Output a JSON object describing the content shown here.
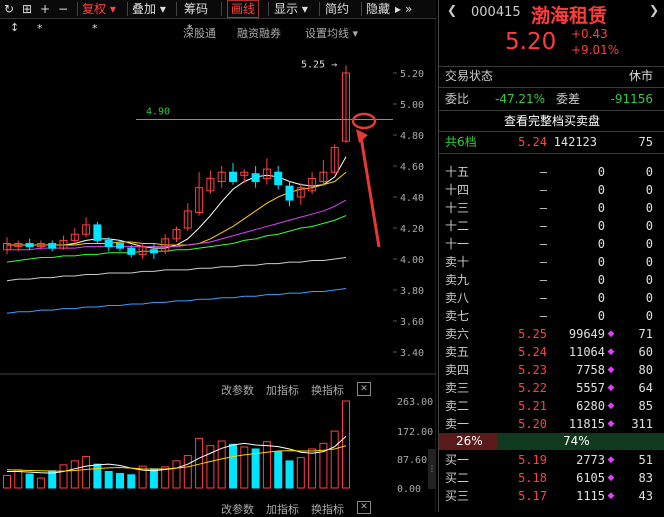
{
  "toolbar": {
    "refresh_icon": "refresh-icon",
    "grid_icon": "grid-icon",
    "plus": "+",
    "minus": "−",
    "fuquan": "复权",
    "diejia": "叠加",
    "chouma": "筹码",
    "huaxian": "画线",
    "xianshi": "显示",
    "jianyue": "简约",
    "yincang": "隐藏",
    "more": "»"
  },
  "chart_header": {
    "stars": [
      "↕",
      "*",
      "*",
      "*"
    ],
    "links": [
      "深股通",
      "融资融券",
      "设置均线"
    ],
    "dropdown": "▾"
  },
  "chart_data": {
    "type": "candlestick",
    "ylim": [
      3.3,
      5.3
    ],
    "y_ticks": [
      "5.20",
      "5.00",
      "4.80",
      "4.60",
      "4.40",
      "4.20",
      "4.00",
      "3.80",
      "3.60",
      "3.40"
    ],
    "high_annotation": "5.25",
    "ref_line": "4.90",
    "candles": [
      {
        "o": 4.06,
        "c": 4.1,
        "h": 4.14,
        "l": 4.03
      },
      {
        "o": 4.08,
        "c": 4.1,
        "h": 4.12,
        "l": 4.05
      },
      {
        "o": 4.1,
        "c": 4.08,
        "h": 4.13,
        "l": 4.06
      },
      {
        "o": 4.08,
        "c": 4.1,
        "h": 4.12,
        "l": 4.06
      },
      {
        "o": 4.1,
        "c": 4.07,
        "h": 4.12,
        "l": 4.05
      },
      {
        "o": 4.07,
        "c": 4.12,
        "h": 4.15,
        "l": 4.06
      },
      {
        "o": 4.12,
        "c": 4.16,
        "h": 4.2,
        "l": 4.1
      },
      {
        "o": 4.16,
        "c": 4.22,
        "h": 4.27,
        "l": 4.14
      },
      {
        "o": 4.22,
        "c": 4.12,
        "h": 4.24,
        "l": 4.1
      },
      {
        "o": 4.12,
        "c": 4.08,
        "h": 4.14,
        "l": 4.05
      },
      {
        "o": 4.1,
        "c": 4.07,
        "h": 4.12,
        "l": 4.05
      },
      {
        "o": 4.07,
        "c": 4.03,
        "h": 4.09,
        "l": 4.01
      },
      {
        "o": 4.03,
        "c": 4.08,
        "h": 4.1,
        "l": 4.0
      },
      {
        "o": 4.06,
        "c": 4.04,
        "h": 4.1,
        "l": 4.0
      },
      {
        "o": 4.05,
        "c": 4.13,
        "h": 4.16,
        "l": 4.03
      },
      {
        "o": 4.13,
        "c": 4.19,
        "h": 4.21,
        "l": 4.11
      },
      {
        "o": 4.2,
        "c": 4.31,
        "h": 4.36,
        "l": 4.18
      },
      {
        "o": 4.3,
        "c": 4.46,
        "h": 4.56,
        "l": 4.28
      },
      {
        "o": 4.44,
        "c": 4.52,
        "h": 4.57,
        "l": 4.42
      },
      {
        "o": 4.5,
        "c": 4.56,
        "h": 4.6,
        "l": 4.46
      },
      {
        "o": 4.56,
        "c": 4.5,
        "h": 4.62,
        "l": 4.48
      },
      {
        "o": 4.54,
        "c": 4.56,
        "h": 4.58,
        "l": 4.49
      },
      {
        "o": 4.55,
        "c": 4.5,
        "h": 4.6,
        "l": 4.46
      },
      {
        "o": 4.52,
        "c": 4.58,
        "h": 4.65,
        "l": 4.48
      },
      {
        "o": 4.56,
        "c": 4.48,
        "h": 4.6,
        "l": 4.45
      },
      {
        "o": 4.47,
        "c": 4.38,
        "h": 4.5,
        "l": 4.34
      },
      {
        "o": 4.4,
        "c": 4.46,
        "h": 4.49,
        "l": 4.35
      },
      {
        "o": 4.44,
        "c": 4.52,
        "h": 4.56,
        "l": 4.42
      },
      {
        "o": 4.5,
        "c": 4.56,
        "h": 4.64,
        "l": 4.47
      },
      {
        "o": 4.56,
        "c": 4.72,
        "h": 4.74,
        "l": 4.55
      },
      {
        "o": 4.76,
        "c": 5.2,
        "h": 5.25,
        "l": 4.75
      }
    ],
    "ma_lines": [
      {
        "name": "ma5",
        "color": "#ffffff",
        "values": [
          4.09,
          4.09,
          4.09,
          4.09,
          4.09,
          4.09,
          4.1,
          4.12,
          4.13,
          4.13,
          4.12,
          4.1,
          4.08,
          4.07,
          4.07,
          4.09,
          4.13,
          4.2,
          4.28,
          4.37,
          4.45,
          4.5,
          4.53,
          4.54,
          4.53,
          4.5,
          4.48,
          4.47,
          4.48,
          4.53,
          4.66
        ]
      },
      {
        "name": "ma10",
        "color": "#ffd000",
        "values": [
          4.09,
          4.09,
          4.09,
          4.09,
          4.09,
          4.09,
          4.09,
          4.1,
          4.1,
          4.1,
          4.11,
          4.11,
          4.1,
          4.1,
          4.09,
          4.09,
          4.09,
          4.1,
          4.13,
          4.17,
          4.21,
          4.26,
          4.31,
          4.36,
          4.4,
          4.43,
          4.45,
          4.46,
          4.48,
          4.5,
          4.56
        ]
      },
      {
        "name": "ma20",
        "color": "#e040fb",
        "values": [
          4.06,
          4.06,
          4.06,
          4.07,
          4.07,
          4.07,
          4.07,
          4.08,
          4.08,
          4.08,
          4.08,
          4.08,
          4.08,
          4.08,
          4.08,
          4.08,
          4.09,
          4.1,
          4.11,
          4.13,
          4.15,
          4.17,
          4.19,
          4.21,
          4.23,
          4.25,
          4.27,
          4.29,
          4.31,
          4.34,
          4.38
        ]
      },
      {
        "name": "ma30",
        "color": "#33ff33",
        "values": [
          3.98,
          3.99,
          4.0,
          4.01,
          4.01,
          4.02,
          4.02,
          4.03,
          4.03,
          4.04,
          4.04,
          4.04,
          4.05,
          4.05,
          4.05,
          4.06,
          4.06,
          4.07,
          4.08,
          4.09,
          4.1,
          4.12,
          4.13,
          4.15,
          4.16,
          4.18,
          4.2,
          4.21,
          4.23,
          4.25,
          4.28
        ]
      },
      {
        "name": "ma60",
        "color": "#cccccc",
        "values": [
          3.86,
          3.87,
          3.87,
          3.88,
          3.88,
          3.89,
          3.89,
          3.9,
          3.9,
          3.91,
          3.91,
          3.91,
          3.92,
          3.92,
          3.93,
          3.93,
          3.93,
          3.94,
          3.94,
          3.95,
          3.95,
          3.96,
          3.96,
          3.97,
          3.97,
          3.98,
          3.98,
          3.99,
          3.99,
          4.0,
          4.01
        ]
      },
      {
        "name": "ma120",
        "color": "#3aa0ff",
        "values": [
          3.65,
          3.66,
          3.66,
          3.67,
          3.67,
          3.68,
          3.68,
          3.69,
          3.69,
          3.7,
          3.7,
          3.71,
          3.71,
          3.72,
          3.72,
          3.73,
          3.73,
          3.74,
          3.74,
          3.75,
          3.75,
          3.76,
          3.76,
          3.77,
          3.77,
          3.78,
          3.78,
          3.79,
          3.79,
          3.8,
          3.81
        ]
      }
    ],
    "volume_ticks": [
      "263.00",
      "172.00",
      "87.60",
      "0.00"
    ],
    "volume_ylim": [
      0,
      263
    ],
    "volumes": [
      38,
      55,
      42,
      30,
      52,
      70,
      82,
      95,
      72,
      50,
      44,
      40,
      66,
      58,
      64,
      82,
      98,
      150,
      128,
      142,
      132,
      124,
      118,
      140,
      110,
      82,
      92,
      118,
      135,
      172,
      263
    ],
    "volume_ma": [
      {
        "color": "#ffffff",
        "values": [
          50,
          50,
          48,
          46,
          45,
          50,
          58,
          66,
          70,
          72,
          68,
          60,
          54,
          52,
          56,
          60,
          72,
          90,
          105,
          120,
          130,
          135,
          130,
          128,
          125,
          118,
          108,
          105,
          110,
          125,
          156
        ]
      },
      {
        "color": "#ffd000",
        "values": [
          55,
          54,
          53,
          52,
          51,
          51,
          53,
          56,
          59,
          61,
          62,
          60,
          58,
          57,
          58,
          60,
          64,
          72,
          80,
          88,
          95,
          100,
          104,
          108,
          112,
          113,
          112,
          112,
          114,
          118,
          128
        ]
      }
    ]
  },
  "volume_toolbar": {
    "gaicanshu": "改参数",
    "jiazhibiao": "加指标",
    "huanzhibiao": "换指标",
    "close": "✕"
  },
  "stock": {
    "code": "000415",
    "name": "渤海租赁",
    "price": "5.20",
    "change": "+0.43",
    "change_pct": "+9.01%"
  },
  "status": {
    "label": "交易状态",
    "value": "休市"
  },
  "weibi": {
    "label": "委比",
    "value": "-47.21%",
    "diff_label": "委差",
    "diff_value": "-91156"
  },
  "view_full": "查看完整档买卖盘",
  "total": {
    "label": "共6档",
    "price": "5.24",
    "vol": "142123",
    "cnt": "75"
  },
  "asks": [
    {
      "label": "十五",
      "price": "—",
      "vol": "0",
      "cnt": "0"
    },
    {
      "label": "十四",
      "price": "—",
      "vol": "0",
      "cnt": "0"
    },
    {
      "label": "十三",
      "price": "—",
      "vol": "0",
      "cnt": "0"
    },
    {
      "label": "十二",
      "price": "—",
      "vol": "0",
      "cnt": "0"
    },
    {
      "label": "十一",
      "price": "—",
      "vol": "0",
      "cnt": "0"
    },
    {
      "label": "卖十",
      "price": "—",
      "vol": "0",
      "cnt": "0"
    },
    {
      "label": "卖九",
      "price": "—",
      "vol": "0",
      "cnt": "0"
    },
    {
      "label": "卖八",
      "price": "—",
      "vol": "0",
      "cnt": "0"
    },
    {
      "label": "卖七",
      "price": "—",
      "vol": "0",
      "cnt": "0"
    },
    {
      "label": "卖六",
      "price": "5.25",
      "vol": "99649",
      "cnt": "71"
    },
    {
      "label": "卖五",
      "price": "5.24",
      "vol": "11064",
      "cnt": "60"
    },
    {
      "label": "卖四",
      "price": "5.23",
      "vol": "7758",
      "cnt": "80"
    },
    {
      "label": "卖三",
      "price": "5.22",
      "vol": "5557",
      "cnt": "64"
    },
    {
      "label": "卖二",
      "price": "5.21",
      "vol": "6280",
      "cnt": "85"
    },
    {
      "label": "卖一",
      "price": "5.20",
      "vol": "11815",
      "cnt": "311"
    }
  ],
  "ratio": {
    "left": "26%",
    "right": "74%"
  },
  "bids": [
    {
      "label": "买一",
      "price": "5.19",
      "vol": "2773",
      "cnt": "51"
    },
    {
      "label": "买二",
      "price": "5.18",
      "vol": "6105",
      "cnt": "83"
    },
    {
      "label": "买三",
      "price": "5.17",
      "vol": "1115",
      "cnt": "43"
    }
  ],
  "colors": {
    "up": "#ff4040",
    "down": "#00e5ff",
    "accent": "#ff3c3c"
  }
}
